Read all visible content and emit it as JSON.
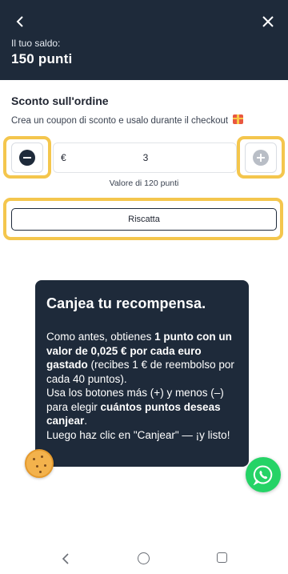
{
  "header": {
    "back_icon": "chevron-left-icon",
    "close_icon": "close-icon",
    "balance_label": "Il tuo saldo:",
    "balance_value": "150 punti",
    "background_color": "#1e2a3a"
  },
  "discount": {
    "title": "Sconto sull'ordine",
    "description": "Crea un coupon di sconto e usalo durante il checkout",
    "gift_icon": "gift-icon",
    "currency_symbol": "€",
    "amount": "3",
    "points_text": "Valore di 120 punti",
    "redeem_label": "Riscatta"
  },
  "highlight_color": "#f4c64d",
  "tooltip": {
    "title": "Canjea tu recompensa.",
    "lines": [
      {
        "pre": "Como antes, obtienes ",
        "bold": "1 punto con un valor de 0,025 € por cada euro gastado",
        "post": " (recibes 1 € de reembolso por cada 40 puntos)."
      },
      {
        "pre": " Usa los botones más (+) y menos (–) para elegir ",
        "bold": "cuántos puntos deseas canjear",
        "post": "."
      },
      {
        "pre": " Luego haz clic en \"Canjear\" — ¡y listo!",
        "bold": "",
        "post": ""
      }
    ]
  },
  "floating": {
    "cookie_icon": "cookie-icon",
    "whatsapp_icon": "whatsapp-icon"
  },
  "navbar": {
    "back_icon": "nav-back-icon",
    "home_icon": "nav-home-icon",
    "recent_icon": "nav-recent-apps-icon"
  }
}
